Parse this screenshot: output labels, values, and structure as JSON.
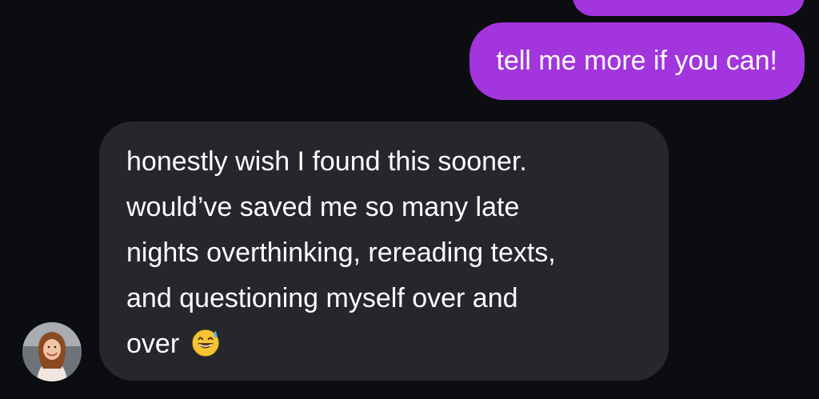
{
  "messages": [
    {
      "direction": "sent",
      "text": ""
    },
    {
      "direction": "sent",
      "text": "tell me more if you can!"
    },
    {
      "direction": "received",
      "lines": [
        "honestly wish I found this sooner.",
        "would’ve saved me so many late",
        "nights overthinking, rereading texts,",
        "and questioning myself over and",
        "over"
      ],
      "emoji": "grinning-face-with-sweat-icon"
    }
  ],
  "colors": {
    "background": "#0c0d10",
    "sent_bubble": "#a235dd",
    "received_bubble": "#26272c",
    "text": "#ffffff"
  },
  "avatar": {
    "icon": "contact-avatar"
  }
}
